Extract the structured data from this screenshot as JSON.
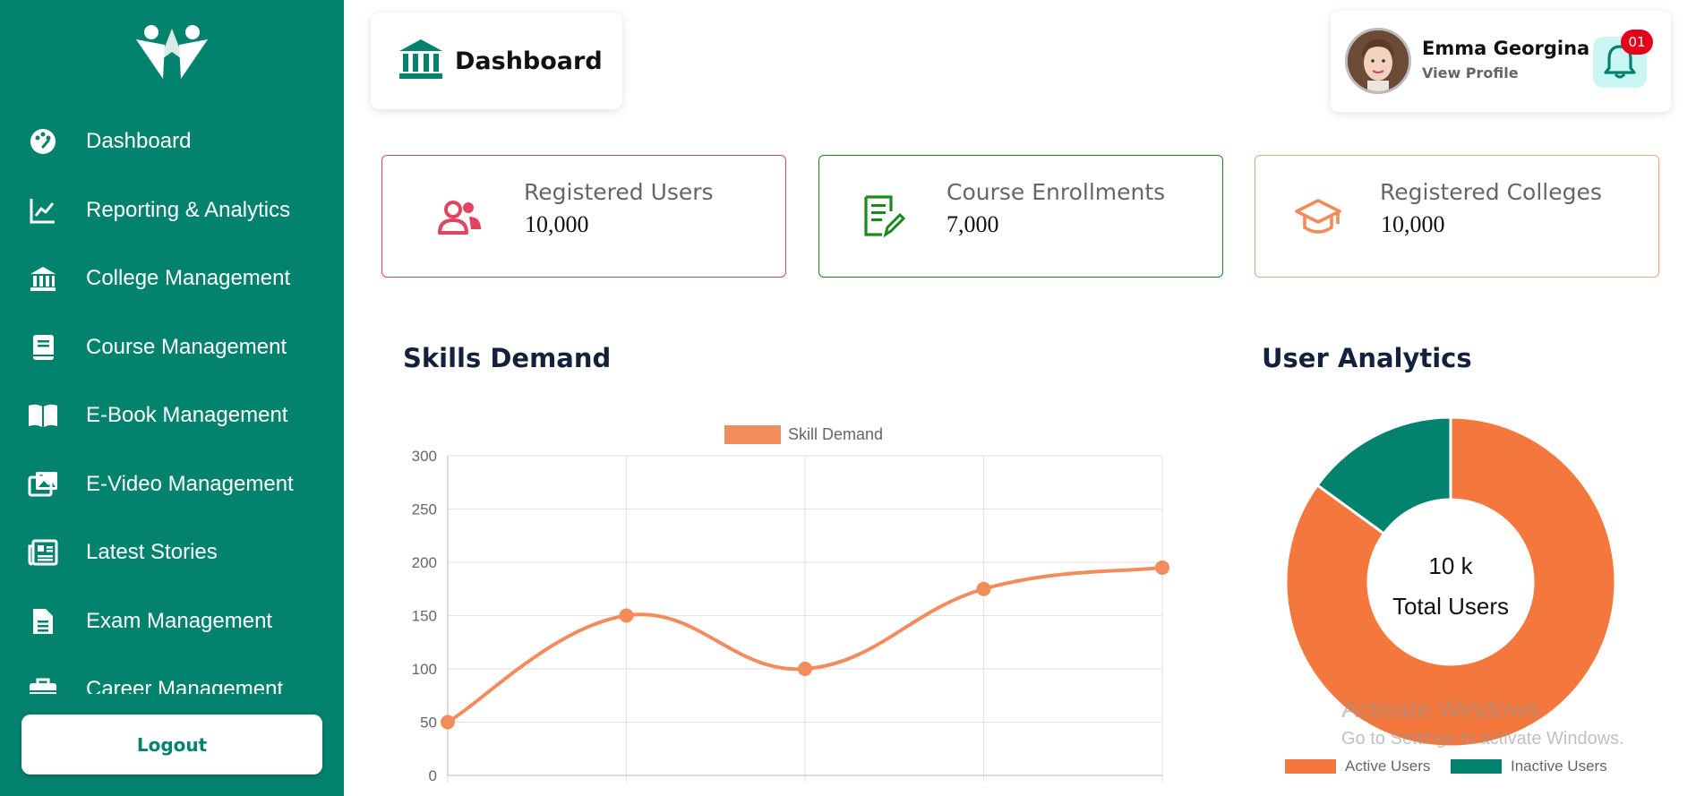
{
  "sidebar": {
    "items": [
      {
        "label": "Dashboard",
        "icon": "palette-icon"
      },
      {
        "label": "Reporting & Analytics",
        "icon": "line-chart-icon"
      },
      {
        "label": "College Management",
        "icon": "bank-icon"
      },
      {
        "label": "Course Management",
        "icon": "book-icon"
      },
      {
        "label": "E-Book Management",
        "icon": "open-book-icon"
      },
      {
        "label": "E-Video Management",
        "icon": "photo-gallery-icon"
      },
      {
        "label": "Latest Stories",
        "icon": "newspaper-icon"
      },
      {
        "label": "Exam Management",
        "icon": "document-icon"
      },
      {
        "label": "Career Management",
        "icon": "briefcase-icon"
      }
    ],
    "logout_label": "Logout"
  },
  "header": {
    "title": "Dashboard",
    "title_icon": "bank-icon"
  },
  "profile": {
    "name": "Emma Georgina",
    "link": "View Profile",
    "notification_count": "01"
  },
  "stats": [
    {
      "label": "Registered Users",
      "value": "10,000",
      "icon": "users-icon",
      "color": "#e0455f"
    },
    {
      "label": "Course Enrollments",
      "value": "7,000",
      "icon": "edit-document-icon",
      "color": "#1a8a1a"
    },
    {
      "label": "Registered Colleges",
      "value": "10,000",
      "icon": "graduation-cap-icon",
      "color": "#f28a5a"
    }
  ],
  "sections": {
    "skills_title": "Skills Demand",
    "analytics_title": "User Analytics"
  },
  "chart_data": [
    {
      "type": "line",
      "title": "Skills Demand",
      "series": [
        {
          "name": "Skill Demand",
          "values": [
            50,
            150,
            100,
            175,
            195
          ],
          "color": "#f28c5c"
        }
      ],
      "ylim": [
        0,
        300
      ],
      "yticks": [
        0,
        50,
        100,
        150,
        200,
        250,
        300
      ],
      "grid": true,
      "legend": "top-center"
    },
    {
      "type": "pie",
      "title": "User Analytics",
      "slices": [
        {
          "name": "Active Users",
          "value": 85,
          "color": "#f4783d"
        },
        {
          "name": "Inactive Users",
          "value": 15,
          "color": "#03836d"
        }
      ],
      "center_value": "10 k",
      "center_label": "Total Users",
      "legend": "bottom"
    }
  ],
  "watermark": {
    "line1": "Activate Windows",
    "line2": "Go to Settings to activate Windows."
  }
}
